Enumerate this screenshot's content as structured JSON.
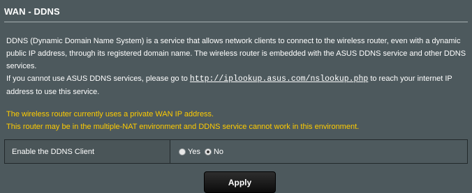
{
  "page": {
    "title": "WAN - DDNS"
  },
  "description": {
    "para1": "DDNS (Dynamic Domain Name System) is a service that allows network clients to connect to the wireless router, even with a dynamic public IP address, through its registered domain name. The wireless router is embedded with the ASUS DDNS service and other DDNS services.",
    "para2_before": "If you cannot use ASUS DDNS services, please go to ",
    "link": "http://iplookup.asus.com/nslookup.php",
    "para2_after": " to reach your internet IP address to use this service."
  },
  "warning": {
    "line1": "The wireless router currently uses a private WAN IP address.",
    "line2": "This router may be in the multiple-NAT environment and DDNS service cannot work in this environment."
  },
  "settings": {
    "ddns_client": {
      "label": "Enable the DDNS Client",
      "options": [
        {
          "label": "Yes",
          "checked": false
        },
        {
          "label": "No",
          "checked": true
        }
      ]
    }
  },
  "actions": {
    "apply_label": "Apply"
  },
  "colors": {
    "background": "#4d595d",
    "warning_text": "#ffcc00",
    "text": "#ffffff"
  }
}
